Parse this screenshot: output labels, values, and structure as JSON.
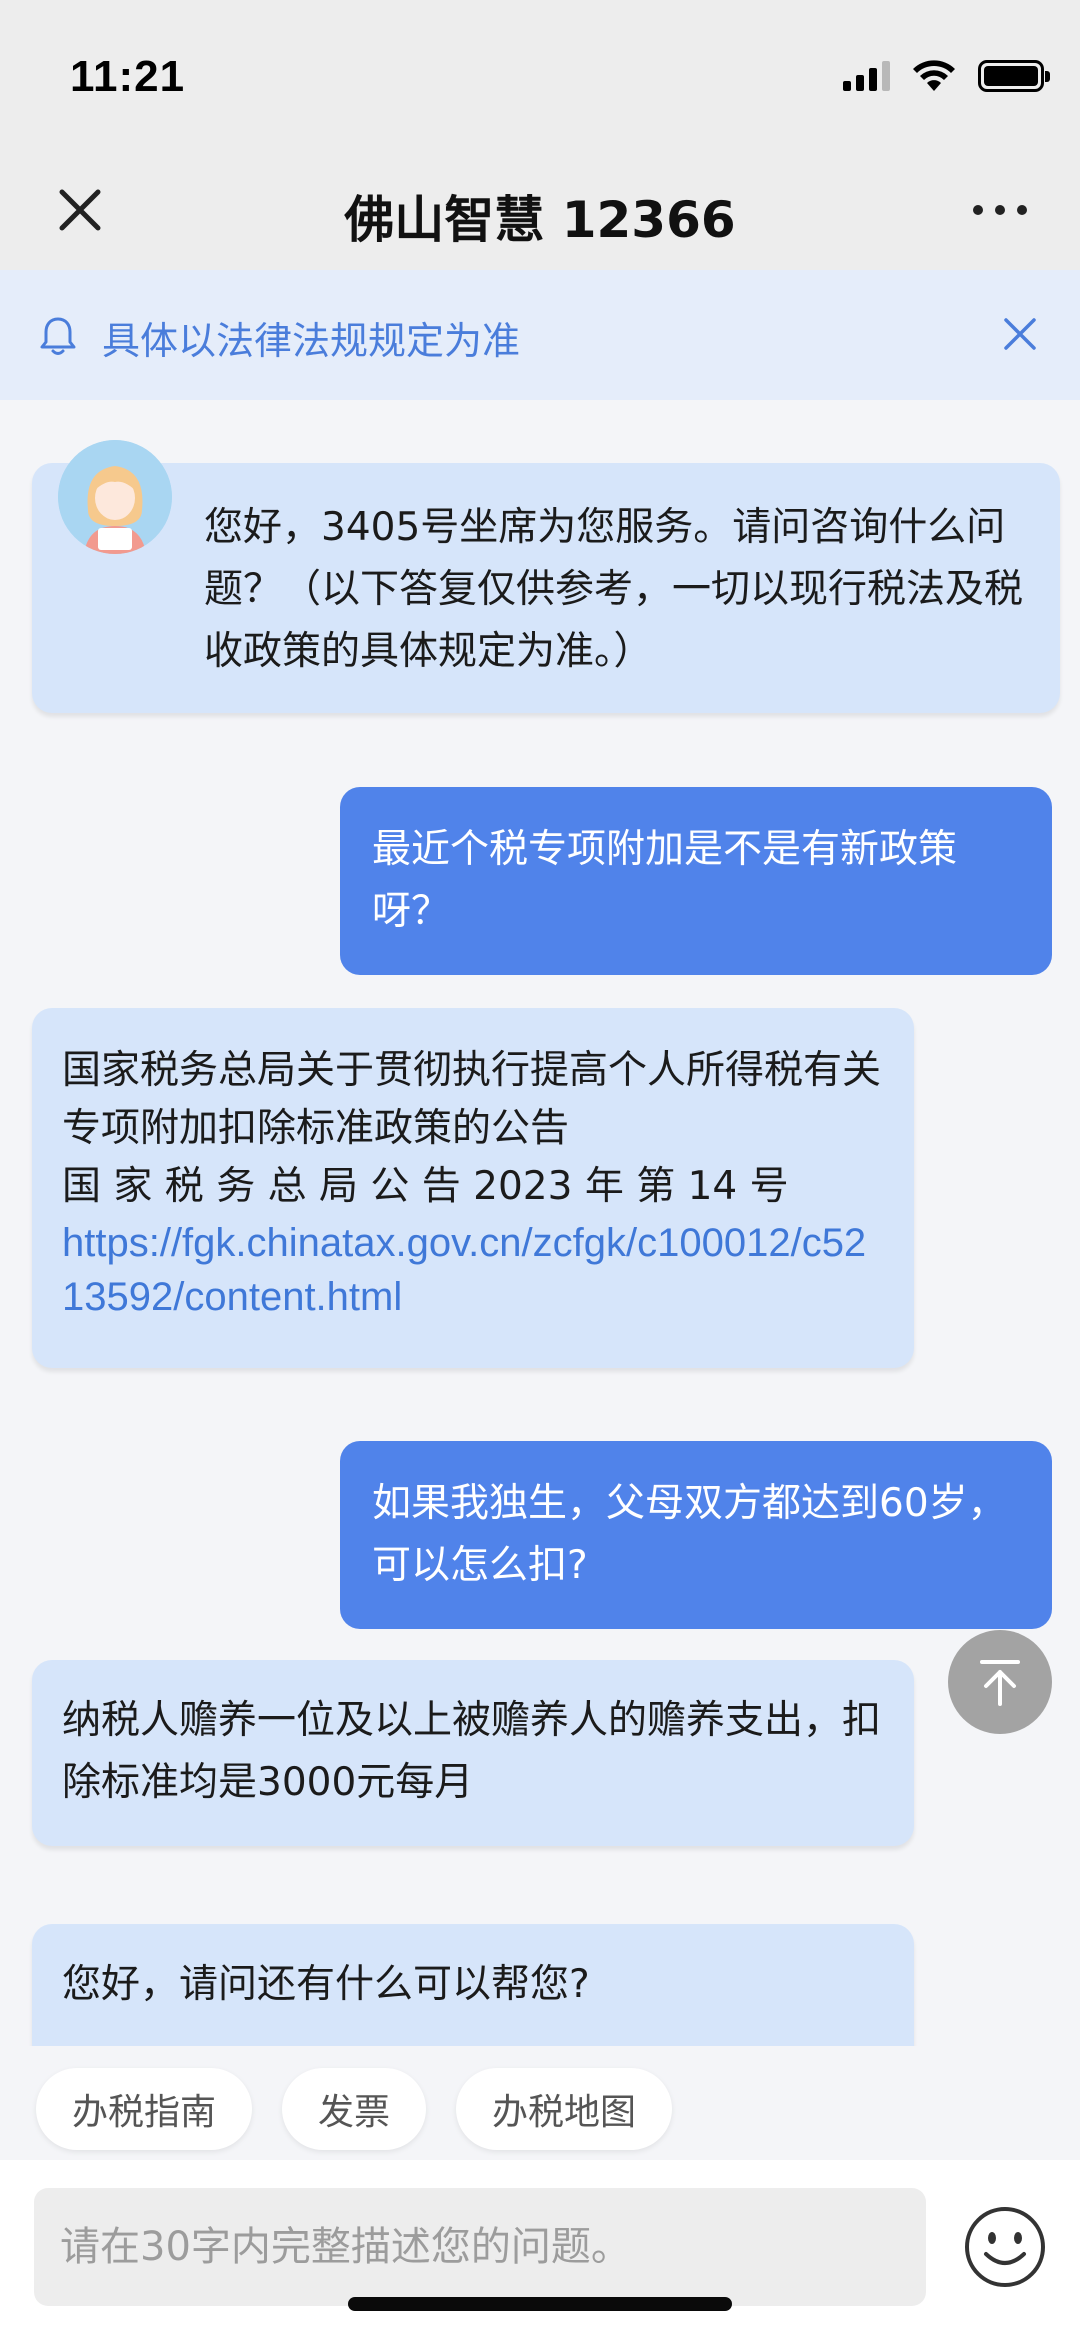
{
  "status_bar": {
    "time": "11:21"
  },
  "nav": {
    "title": "佛山智慧 12366"
  },
  "notice": {
    "text": "具体以法律法规规定为准"
  },
  "messages": [
    {
      "from": "bot",
      "text": "您好，3405号坐席为您服务。请问咨询什么问题？（以下答复仅供参考，一切以现行税法及税收政策的具体规定为准。）"
    },
    {
      "from": "user",
      "text": "最近个税专项附加是不是有新政策呀？"
    },
    {
      "from": "bot",
      "line1": "国家税务总局关于贯彻执行提高个人所得税有关专项附加扣除标准政策的公告",
      "line2": "国 家 税 务 总 局 公 告 2023 年 第 14 号",
      "link": "https://fgk.chinatax.gov.cn/zcfgk/c100012/c5213592/content.html"
    },
    {
      "from": "user",
      "text": "如果我独生，父母双方都达到60岁，可以怎么扣?"
    },
    {
      "from": "bot",
      "text": "纳税人赡养一位及以上被赡养人的赡养支出，扣除标准均是3000元每月"
    },
    {
      "from": "bot",
      "text": "您好，请问还有什么可以帮您?"
    }
  ],
  "quick_replies": [
    "办税指南",
    "发票",
    "办税地图"
  ],
  "input": {
    "placeholder": "请在30字内完整描述您的问题。"
  },
  "colors": {
    "user_bubble": "#5083ea",
    "bot_bubble": "#d6e5fa",
    "link": "#3f78d8",
    "notice_text": "#4a7ddb"
  }
}
